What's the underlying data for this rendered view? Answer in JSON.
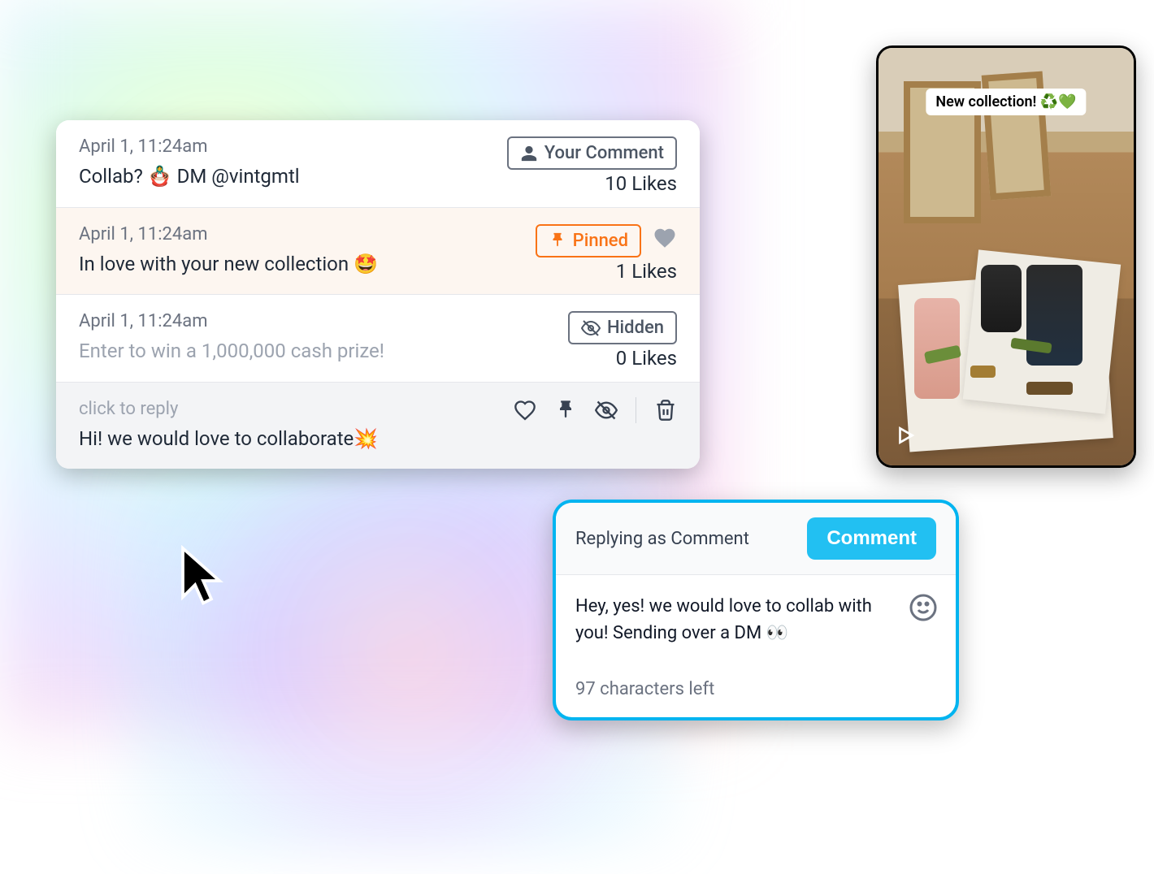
{
  "comments": [
    {
      "timestamp": "April 1, 11:24am",
      "text": "Collab? 🪆 DM @vintgmtl",
      "badge_label": "Your Comment",
      "likes_label": "10 Likes"
    },
    {
      "timestamp": "April 1, 11:24am",
      "text": "In love with your new collection 🤩",
      "badge_label": "Pinned",
      "likes_label": "1 Likes"
    },
    {
      "timestamp": "April 1, 11:24am",
      "text": "Enter to win a 1,000,000 cash prize!",
      "badge_label": "Hidden",
      "likes_label": "0 Likes"
    }
  ],
  "reply_row": {
    "placeholder": "click to reply",
    "text": "Hi! we would love to collaborate💥"
  },
  "video": {
    "caption": "New collection! ♻️💚"
  },
  "compose": {
    "header": "Replying as Comment",
    "submit_label": "Comment",
    "body": "Hey, yes! we would love to collab with you! Sending over a DM 👀",
    "chars_left": "97 characters left"
  }
}
